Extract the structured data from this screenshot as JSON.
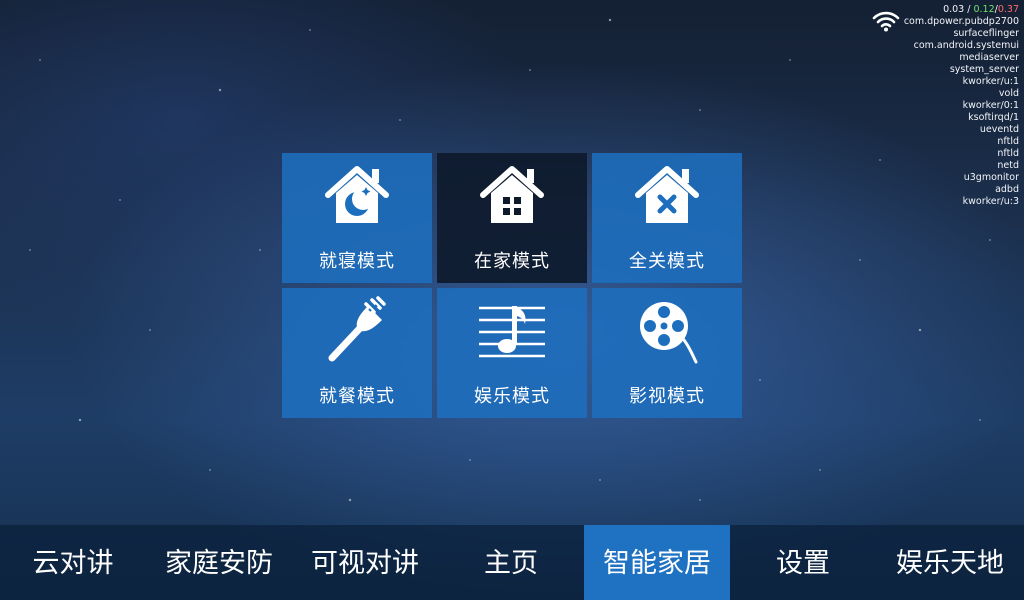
{
  "status": {
    "load_prefix": "0.03 /",
    "load_mid": "0.12",
    "load_sep": "/",
    "load_end": "0.37",
    "processes": [
      "com.dpower.pubdp2700",
      "surfaceflinger",
      "com.android.systemui",
      "mediaserver",
      "system_server",
      "kworker/u:1",
      "vold",
      "kworker/0:1",
      "ksoftirqd/1",
      "ueventd",
      "nftld",
      "nftld",
      "netd",
      "u3gmonitor",
      "adbd",
      "kworker/u:3"
    ]
  },
  "modes": [
    {
      "label": "就寝模式",
      "icon": "house-moon-icon"
    },
    {
      "label": "在家模式",
      "icon": "house-window-icon"
    },
    {
      "label": "全关模式",
      "icon": "house-x-icon"
    },
    {
      "label": "就餐模式",
      "icon": "fork-icon"
    },
    {
      "label": "娱乐模式",
      "icon": "music-note-icon"
    },
    {
      "label": "影视模式",
      "icon": "film-reel-icon"
    }
  ],
  "nav": {
    "items": [
      "云对讲",
      "家庭安防",
      "可视对讲",
      "主页",
      "智能家居",
      "设置",
      "娱乐天地"
    ],
    "active": "智能家居"
  },
  "colors": {
    "tile": "#1e6ebe",
    "tile_active": "#0e1a2c",
    "nav_active": "#1f72c2",
    "load_green": "#6fe06f",
    "load_red": "#ff6a6a"
  }
}
